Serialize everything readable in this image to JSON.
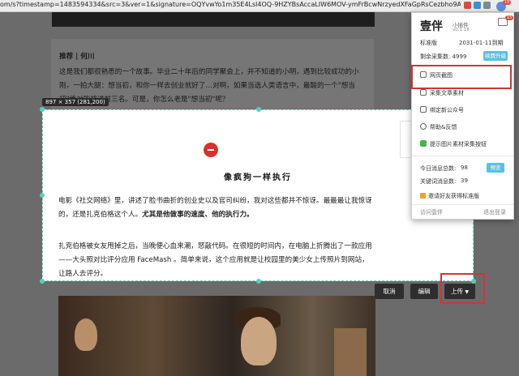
{
  "browser": {
    "url": "om/s?timestamp=1483594334&src=3&ver=1&signature=OQYvwYo1m35E4Lsl4OQ-9HZYBsAccaLIW6MOV-ymFrBcwNrzyedXFaGpRsCezbho9AYQX9gN..."
  },
  "article": {
    "recommend_label": "推荐 | 何川",
    "quote_text": "这是我们都很熟悉的一个故事。毕业二十年后的同学聚会上，并不知道的小明，遇到比较成功的小刚，一拍大腿：想当初，和你一样去创业就好了…对啊，如果当选人类语言中，最酸的一个\"想当初\"绝对能排进前三名。可是，你怎么老是\"想当初\"呢？",
    "title": "像疯狗一样执行",
    "para1_a": "电影《社交网络》里，讲述了脸书曲折的创业史以及官司纠纷，我对这些都并不惊讶。最最最让我惊讶的，还是扎克伯格这个人。",
    "para1_b": "尤其是他做事的速度、他的执行力。",
    "para2": "扎克伯格被女友甩掉之后，当晚便心血来潮，怒敲代码。在很短的时间内，在电脑上折腾出了一款应用——大头照对比评分应用 FaceMash 。简单来说，这个应用就是让校园里的美少女上传照片到网站，让路人去评分。"
  },
  "selection": {
    "size_label": "897 × 357 (281,200)"
  },
  "toolbar": {
    "cancel": "取消",
    "edit": "编辑",
    "upload": "上传"
  },
  "popup": {
    "brand": "壹伴",
    "sub_name": "小插件",
    "version": "v0.1.18",
    "edition": "标准版",
    "expiry": "2031-01-11到期",
    "remaining": "剩余采集数: 4999",
    "upgrade": "续费升级",
    "menu": [
      "网页截图",
      "采集文章素材",
      "绑定新公众号",
      "帮助&反馈",
      "提示图片素材采集按钮"
    ],
    "today_msgs_label": "今日消息总数:",
    "today_msgs_value": "98",
    "keyword_msgs_label": "关键词消息数:",
    "keyword_msgs_value": "39",
    "view": "预览",
    "invite": "邀请好友获得标准版",
    "visit": "访问壹伴",
    "logout": "退出登录",
    "badge_count": "15"
  },
  "colors": {
    "accent": "#4fd2bd",
    "highlight_red": "#d0343a",
    "upgrade_blue": "#5bc0de",
    "logo_red": "#d8322c"
  }
}
